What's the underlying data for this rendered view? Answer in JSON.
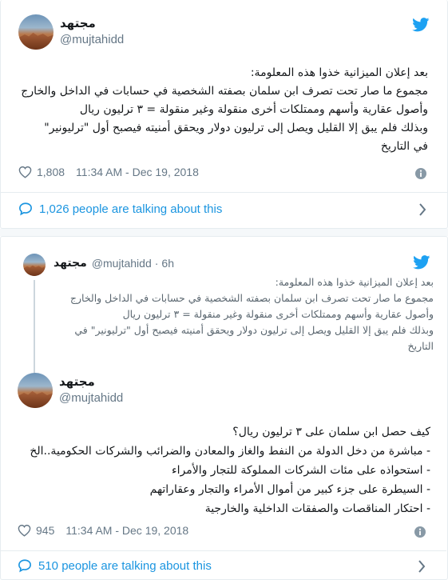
{
  "tweet1": {
    "display_name": "مجتهد",
    "handle": "@mujtahidd",
    "lines": [
      "بعد إعلان الميزانية خذوا هذه المعلومة:",
      "مجموع ما صار تحت تصرف ابن سلمان بصفته الشخصية في حسابات في الداخل والخارج",
      "وأصول عقارية وأسهم وممتلكات أخرى منقولة وغير منقولة = ٣ ترليون ريال",
      "وبذلك فلم يبق إلا القليل ويصل إلى ترليون دولار ويحقق أمنيته فيصبح أول \"ترليونير\"",
      "في التاريخ"
    ],
    "likes": "1,808",
    "timestamp": "11:34 AM - Dec 19, 2018",
    "talking": "1,026 people are talking about this"
  },
  "tweet2": {
    "quoted": {
      "display_name": "مجتهد",
      "handle": "@mujtahidd",
      "time": "6h",
      "lines": [
        "بعد إعلان الميزانية خذوا هذه المعلومة:",
        "مجموع ما صار تحت تصرف ابن سلمان بصفته الشخصية في حسابات في الداخل والخارج",
        "وأصول عقارية وأسهم وممتلكات أخرى منقولة وغير منقولة = ٣ ترليون ريال",
        "وبذلك فلم يبق إلا القليل ويصل إلى ترليون دولار ويحقق أمنيته فيصبح أول \"ترليونير\" في",
        "التاريخ"
      ]
    },
    "display_name": "مجتهد",
    "handle": "@mujtahidd",
    "lines": [
      "كيف حصل ابن سلمان على ٣ ترليون ريال؟",
      "- مباشرة من دخل الدولة من النفط والغاز والمعادن والضرائب والشركات الحكومية..الخ",
      "- استحواذه على مئات الشركات المملوكة للتجار والأمراء",
      "- السيطرة على جزء كبير من أموال الأمراء والتجار وعقاراتهم",
      "- احتكار المناقصات والصفقات الداخلية والخارجية"
    ],
    "likes": "945",
    "timestamp": "11:34 AM - Dec 19, 2018",
    "talking": "510 people are talking about this"
  },
  "colors": {
    "twitter_blue": "#1da1f2",
    "link_blue": "#1b95e0",
    "muted": "#657786",
    "border": "#e6ecf0"
  },
  "icons": [
    "twitter-bird-icon",
    "heart-icon",
    "info-icon",
    "speech-bubble-icon",
    "chevron-right-icon"
  ]
}
